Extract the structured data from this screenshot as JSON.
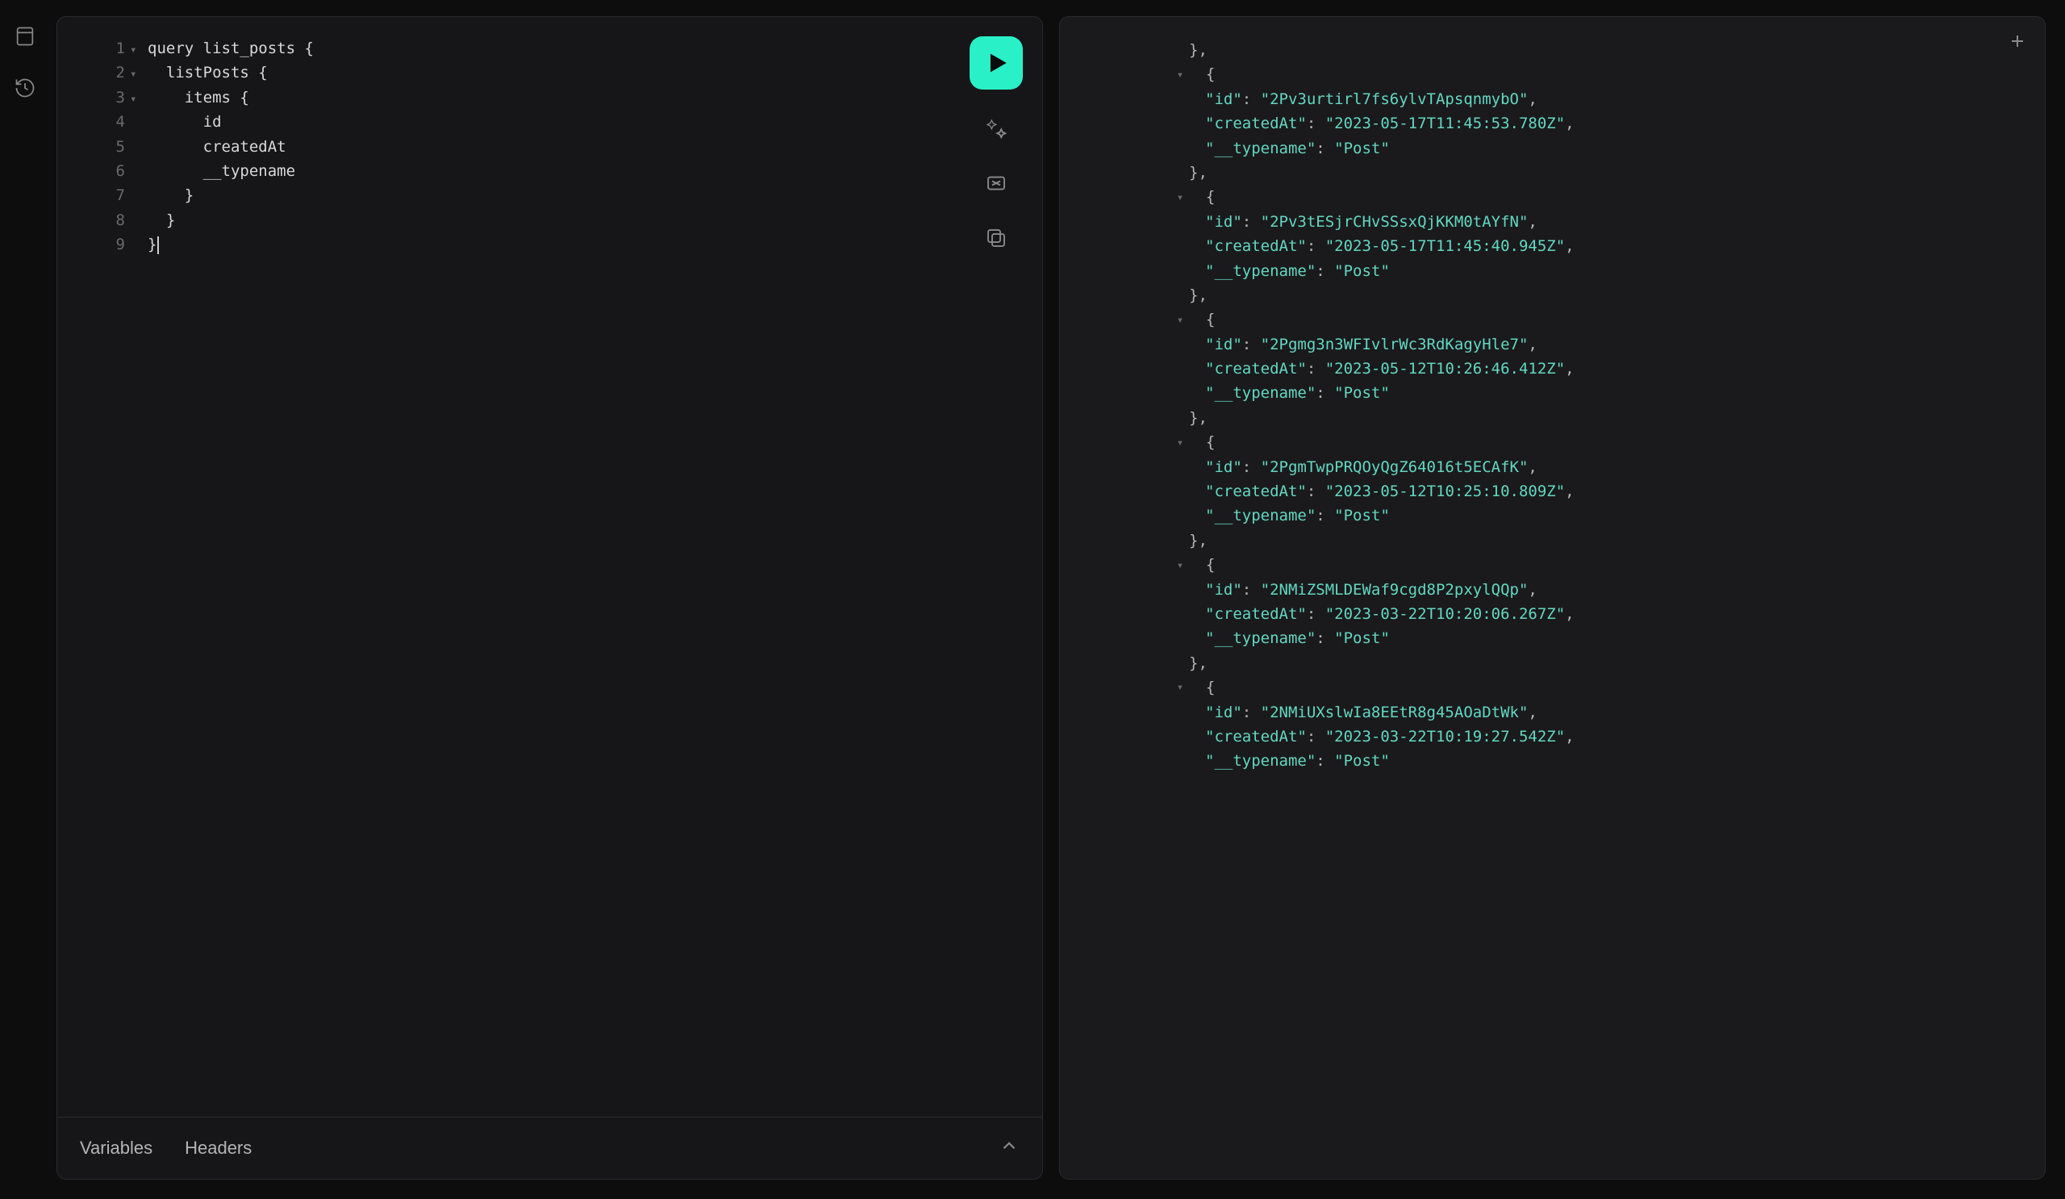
{
  "rail": {
    "items": [
      {
        "name": "explorer-icon"
      },
      {
        "name": "history-icon"
      }
    ]
  },
  "editor": {
    "lines": [
      {
        "n": "1",
        "fold": true,
        "text": "query list_posts {"
      },
      {
        "n": "2",
        "fold": true,
        "text": "  listPosts {"
      },
      {
        "n": "3",
        "fold": true,
        "text": "    items {"
      },
      {
        "n": "4",
        "fold": false,
        "text": "      id"
      },
      {
        "n": "5",
        "fold": false,
        "text": "      createdAt"
      },
      {
        "n": "6",
        "fold": false,
        "text": "      __typename"
      },
      {
        "n": "7",
        "fold": false,
        "text": "    }"
      },
      {
        "n": "8",
        "fold": false,
        "text": "  }"
      },
      {
        "n": "9",
        "fold": false,
        "text": "}"
      }
    ]
  },
  "toolbar": {
    "run": "Run",
    "tools": [
      {
        "name": "prettify-icon"
      },
      {
        "name": "merge-icon"
      },
      {
        "name": "copy-icon"
      }
    ]
  },
  "bottom": {
    "tabs": [
      "Variables",
      "Headers"
    ]
  },
  "response": {
    "items": [
      {
        "id": "2Pv3urtirl7fs6ylvTApsqnmybO",
        "createdAt": "2023-05-17T11:45:53.780Z",
        "typename": "Post"
      },
      {
        "id": "2Pv3tESjrCHvSSsxQjKKM0tAYfN",
        "createdAt": "2023-05-17T11:45:40.945Z",
        "typename": "Post"
      },
      {
        "id": "2Pgmg3n3WFIvlrWc3RdKagyHle7",
        "createdAt": "2023-05-12T10:26:46.412Z",
        "typename": "Post"
      },
      {
        "id": "2PgmTwpPRQOyQgZ64016t5ECAfK",
        "createdAt": "2023-05-12T10:25:10.809Z",
        "typename": "Post"
      },
      {
        "id": "2NMiZSMLDEWaf9cgd8P2pxylQQp",
        "createdAt": "2023-03-22T10:20:06.267Z",
        "typename": "Post"
      },
      {
        "id": "2NMiUXslwIa8EEtR8g45AOaDtWk",
        "createdAt": "2023-03-22T10:19:27.542Z",
        "typename": "Post"
      }
    ],
    "keys": {
      "id": "id",
      "createdAt": "createdAt",
      "typename": "__typename"
    }
  }
}
